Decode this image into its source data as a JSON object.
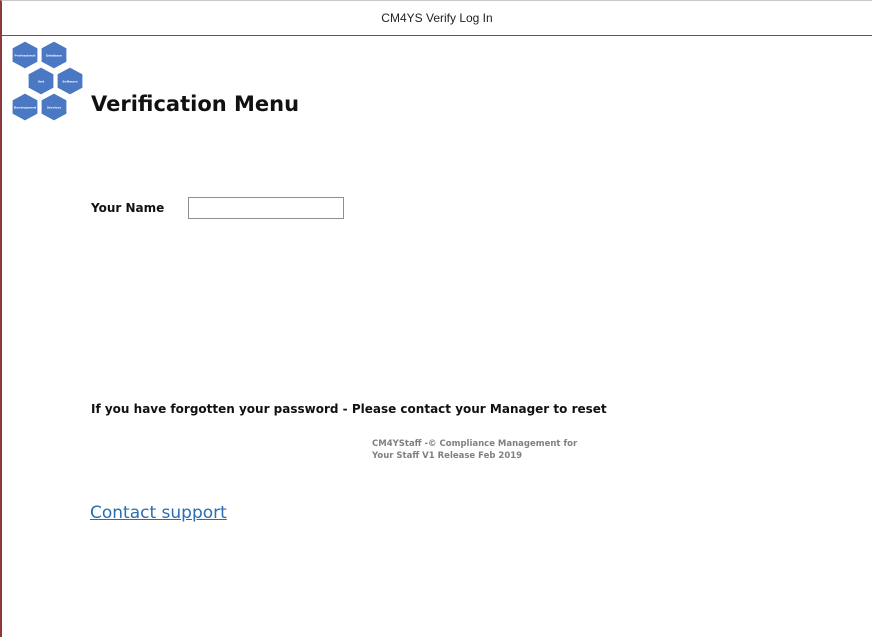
{
  "window": {
    "title": "CM4YS Verify Log In"
  },
  "logo": {
    "hexagons": [
      {
        "label": "Professional"
      },
      {
        "label": "Database"
      },
      {
        "label": "And"
      },
      {
        "label": "Software"
      },
      {
        "label": "Development"
      },
      {
        "label": "Services"
      }
    ],
    "color": "#4a78c2"
  },
  "page": {
    "heading": "Verification Menu"
  },
  "form": {
    "name_label": "Your Name",
    "name_value": ""
  },
  "messages": {
    "forgot_password": "If you have forgotten your password - Please contact your Manager to reset",
    "copyright_line1": "CM4YStaff -© Compliance Management for",
    "copyright_line2": "Your Staff  V1 Release Feb 2019"
  },
  "links": {
    "contact_support": "Contact support"
  },
  "colors": {
    "accent_border": "#9b3b3b",
    "link": "#2a6db5"
  }
}
